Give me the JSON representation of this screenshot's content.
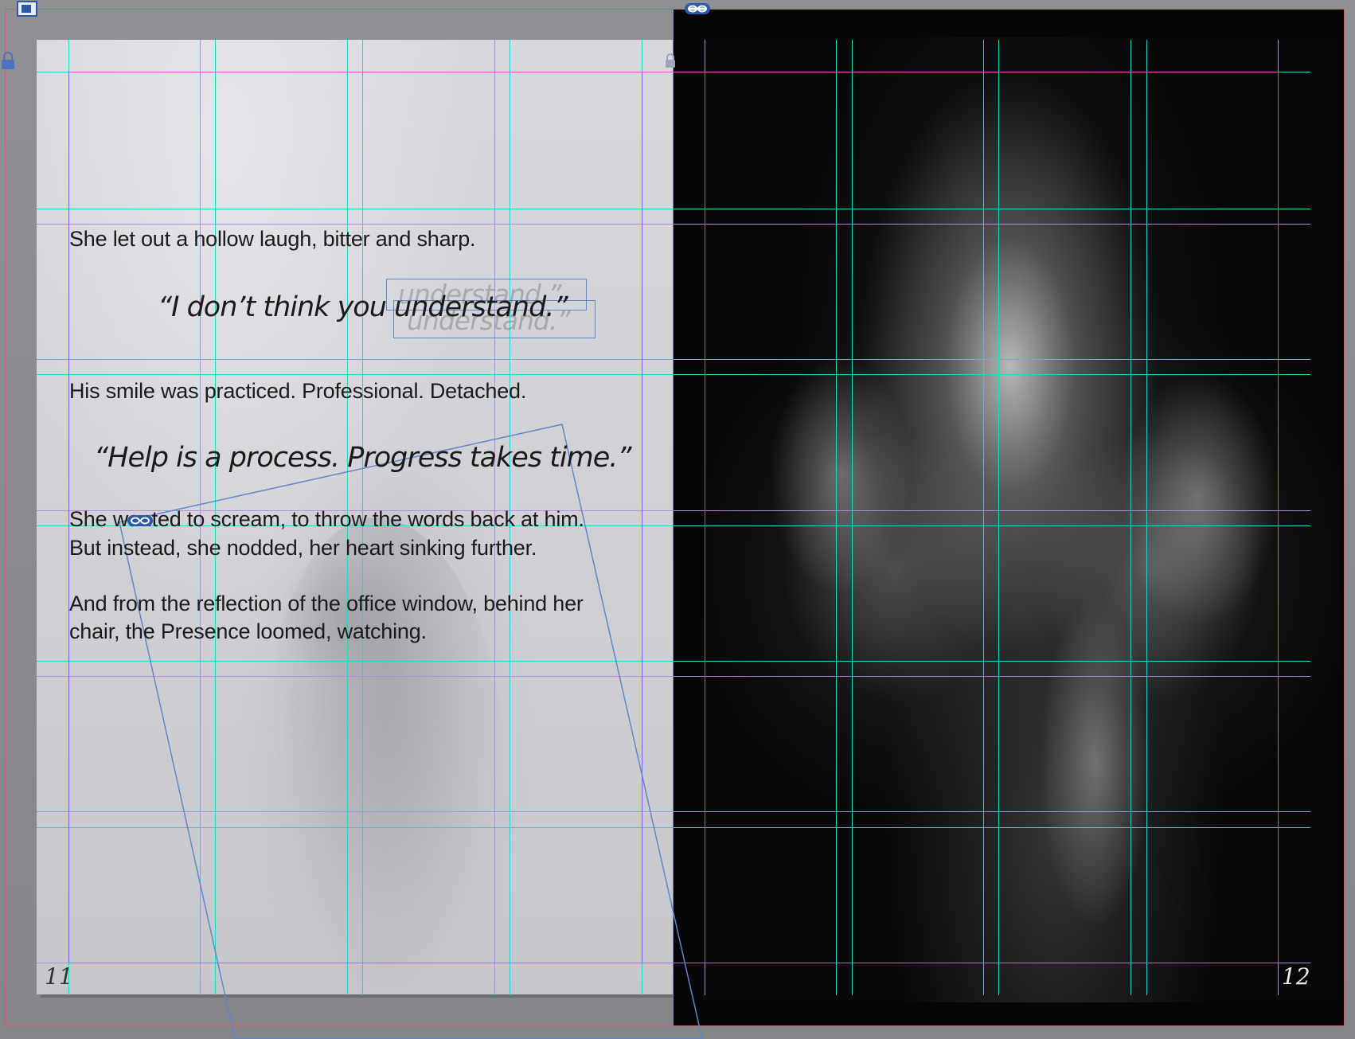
{
  "document": {
    "left_page": {
      "paragraph_1": "She let out a hollow laugh, bitter and sharp.",
      "quote_1": "“I don’t think you understand.”",
      "overset_ghost_1": "understand.”",
      "overset_ghost_2": "understand.”",
      "paragraph_2": "His smile was practiced. Professional. Detached.",
      "quote_2": "“Help is a process. Progress takes time.”",
      "paragraph_3_line_1": "She wanted to scream, to throw the words back at him.",
      "paragraph_3_line_2": "But instead, she nodded, her heart sinking further.",
      "paragraph_4_line_1": "And from the reflection of the office window, behind her",
      "paragraph_4_line_2": "chair, the Presence loomed, watching.",
      "page_number": "11"
    },
    "right_page": {
      "page_number": "12"
    }
  },
  "icons": {
    "top_left": "page-tool-icon",
    "link": "link-chain-icon",
    "lock": "lock-icon"
  },
  "colors": {
    "guide_cyan": "#22d3dd",
    "margin_magenta": "#d05bd8",
    "column_purple": "#8a5cf0",
    "bleed_red": "#c9606e",
    "frame_blue": "#5e86c9"
  }
}
